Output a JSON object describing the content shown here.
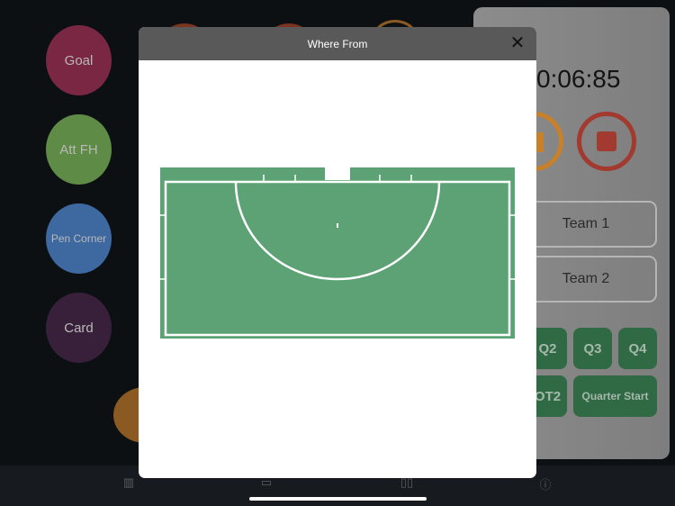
{
  "actions": [
    {
      "label": "Goal",
      "color": "#7a2743"
    },
    {
      "label": "Att FH",
      "color": "#5e8b45"
    },
    {
      "label": "Pen Corner",
      "color": "#3e68a0"
    },
    {
      "label": "Card",
      "color": "#38203a"
    }
  ],
  "timer": {
    "value": "0:06:85",
    "pause_color": "#c9802a",
    "stop_color": "#a33a30"
  },
  "teams": [
    "Team 1",
    "Team 2"
  ],
  "quarters": [
    "Q2",
    "Q3",
    "Q4",
    "OT2",
    "Quarter Start"
  ],
  "modal": {
    "title": "Where From",
    "close_icon": "close-icon",
    "pitch_color": "#5ca274"
  },
  "tabbar": [
    {
      "icon": "pitch-icon"
    },
    {
      "icon": "square-icon"
    },
    {
      "icon": "bars-icon"
    },
    {
      "icon": "info-icon"
    }
  ]
}
